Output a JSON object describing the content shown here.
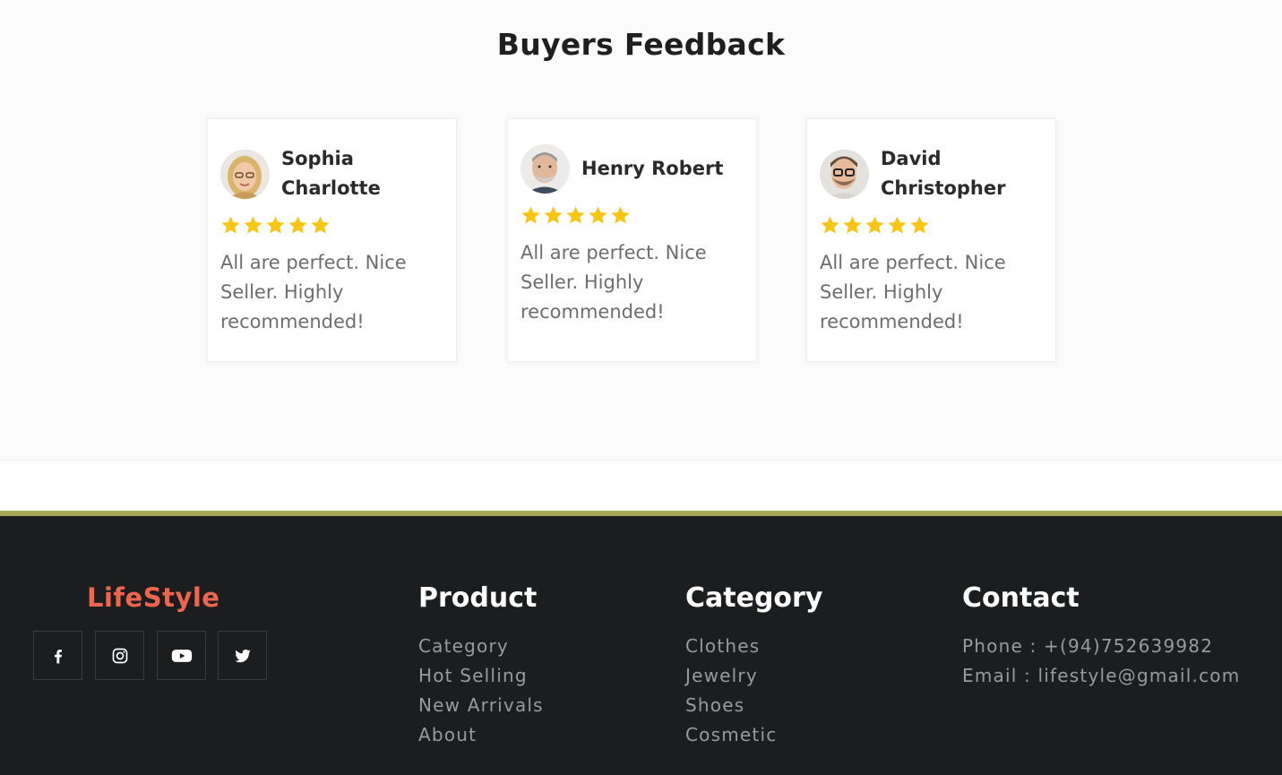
{
  "feedback": {
    "title": "Buyers Feedback",
    "reviews": [
      {
        "name": "Sophia Charlotte",
        "rating": 5,
        "text": "All are perfect. Nice Seller. Highly recommended!"
      },
      {
        "name": "Henry Robert",
        "rating": 5,
        "text": "All are perfect. Nice Seller. Highly recommended!"
      },
      {
        "name": "David Christopher",
        "rating": 5,
        "text": "All are perfect. Nice Seller. Highly recommended!"
      }
    ]
  },
  "footer": {
    "brand": "LifeStyle",
    "social": [
      {
        "icon": "facebook-icon"
      },
      {
        "icon": "instagram-icon"
      },
      {
        "icon": "youtube-icon"
      },
      {
        "icon": "twitter-icon"
      }
    ],
    "product": {
      "title": "Product",
      "links": [
        "Category",
        "Hot Selling",
        "New Arrivals",
        "About"
      ]
    },
    "category": {
      "title": "Category",
      "links": [
        "Clothes",
        "Jewelry",
        "Shoes",
        "Cosmetic"
      ]
    },
    "contact": {
      "title": "Contact",
      "phone": "Phone : +(94)752639982",
      "email": "Email : lifestyle@gmail.com"
    }
  },
  "colors": {
    "star": "#f9c513",
    "brand": "#f0654d",
    "footer_bg": "#1c1d1f",
    "footer_accent": "#a8a85c"
  }
}
